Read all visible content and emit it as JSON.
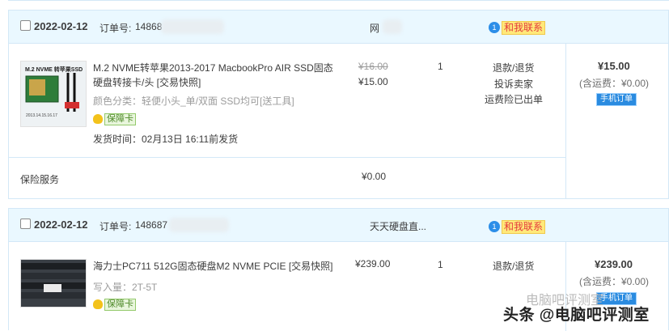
{
  "orders": [
    {
      "date": "2022-02-12",
      "order_no_label": "订单号:",
      "order_no": "14868",
      "shop": "网",
      "contact_label": "和我联系",
      "product": {
        "title": "M.2 NVME转苹果2013-2017 MacbookPro AIR SSD固态硬盘转接卡/头 [交易快照]",
        "title_line1": "M.2 NVME转苹果2013-2017 MacbookPro AIR SSD固态",
        "title_line2": "硬盘转接卡/头 [交易快照]",
        "spec": "颜色分类：轻便小头_单/双面 SSD均可[送工具]",
        "guarantee": "保障卡",
        "ship_time": "发货时间：02月13日 16:11前发货",
        "thumb_label": "M.2 NVME 转苹果SSD",
        "orig_price": "¥16.00",
        "price": "¥15.00",
        "qty": "1",
        "actions": [
          "退款/退货",
          "投诉卖家",
          "运费险已出单"
        ],
        "total": "¥15.00",
        "shipping": "(含运费：¥0.00)",
        "mobile_badge": "手机订单"
      },
      "service": {
        "label": "保险服务",
        "price": "¥0.00"
      }
    },
    {
      "date": "2022-02-12",
      "order_no_label": "订单号:",
      "order_no": "148687",
      "shop": "天天硬盘直...",
      "contact_label": "和我联系",
      "product": {
        "title": "海力士PC711 512G固态硬盘M2 NVME PCIE [交易快照]",
        "spec": "写入量：2T-5T",
        "guarantee": "保障卡",
        "price": "¥239.00",
        "qty": "1",
        "actions": [
          "退款/退货"
        ],
        "total": "¥239.00",
        "shipping": "(含运费：¥0.00)",
        "mobile_badge": "手机订单"
      }
    }
  ],
  "watermark": {
    "line1": "电脑吧评测室",
    "line2": "头条 @电脑吧评测室"
  }
}
